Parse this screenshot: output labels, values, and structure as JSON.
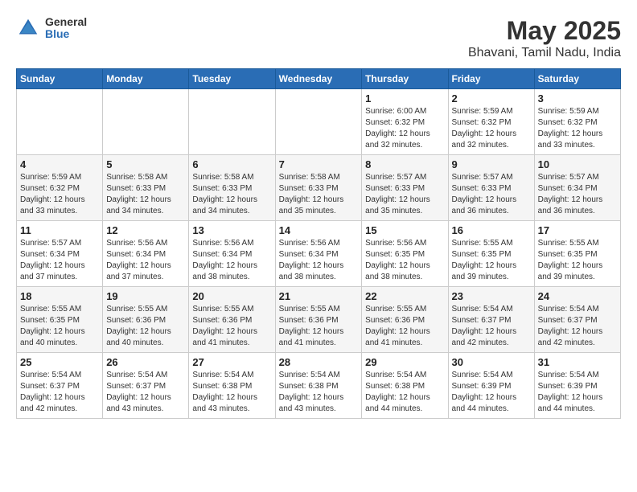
{
  "logo": {
    "general": "General",
    "blue": "Blue"
  },
  "title": "May 2025",
  "subtitle": "Bhavani, Tamil Nadu, India",
  "headers": [
    "Sunday",
    "Monday",
    "Tuesday",
    "Wednesday",
    "Thursday",
    "Friday",
    "Saturday"
  ],
  "weeks": [
    [
      {
        "day": "",
        "info": ""
      },
      {
        "day": "",
        "info": ""
      },
      {
        "day": "",
        "info": ""
      },
      {
        "day": "",
        "info": ""
      },
      {
        "day": "1",
        "info": "Sunrise: 6:00 AM\nSunset: 6:32 PM\nDaylight: 12 hours\nand 32 minutes."
      },
      {
        "day": "2",
        "info": "Sunrise: 5:59 AM\nSunset: 6:32 PM\nDaylight: 12 hours\nand 32 minutes."
      },
      {
        "day": "3",
        "info": "Sunrise: 5:59 AM\nSunset: 6:32 PM\nDaylight: 12 hours\nand 33 minutes."
      }
    ],
    [
      {
        "day": "4",
        "info": "Sunrise: 5:59 AM\nSunset: 6:32 PM\nDaylight: 12 hours\nand 33 minutes."
      },
      {
        "day": "5",
        "info": "Sunrise: 5:58 AM\nSunset: 6:33 PM\nDaylight: 12 hours\nand 34 minutes."
      },
      {
        "day": "6",
        "info": "Sunrise: 5:58 AM\nSunset: 6:33 PM\nDaylight: 12 hours\nand 34 minutes."
      },
      {
        "day": "7",
        "info": "Sunrise: 5:58 AM\nSunset: 6:33 PM\nDaylight: 12 hours\nand 35 minutes."
      },
      {
        "day": "8",
        "info": "Sunrise: 5:57 AM\nSunset: 6:33 PM\nDaylight: 12 hours\nand 35 minutes."
      },
      {
        "day": "9",
        "info": "Sunrise: 5:57 AM\nSunset: 6:33 PM\nDaylight: 12 hours\nand 36 minutes."
      },
      {
        "day": "10",
        "info": "Sunrise: 5:57 AM\nSunset: 6:34 PM\nDaylight: 12 hours\nand 36 minutes."
      }
    ],
    [
      {
        "day": "11",
        "info": "Sunrise: 5:57 AM\nSunset: 6:34 PM\nDaylight: 12 hours\nand 37 minutes."
      },
      {
        "day": "12",
        "info": "Sunrise: 5:56 AM\nSunset: 6:34 PM\nDaylight: 12 hours\nand 37 minutes."
      },
      {
        "day": "13",
        "info": "Sunrise: 5:56 AM\nSunset: 6:34 PM\nDaylight: 12 hours\nand 38 minutes."
      },
      {
        "day": "14",
        "info": "Sunrise: 5:56 AM\nSunset: 6:34 PM\nDaylight: 12 hours\nand 38 minutes."
      },
      {
        "day": "15",
        "info": "Sunrise: 5:56 AM\nSunset: 6:35 PM\nDaylight: 12 hours\nand 38 minutes."
      },
      {
        "day": "16",
        "info": "Sunrise: 5:55 AM\nSunset: 6:35 PM\nDaylight: 12 hours\nand 39 minutes."
      },
      {
        "day": "17",
        "info": "Sunrise: 5:55 AM\nSunset: 6:35 PM\nDaylight: 12 hours\nand 39 minutes."
      }
    ],
    [
      {
        "day": "18",
        "info": "Sunrise: 5:55 AM\nSunset: 6:35 PM\nDaylight: 12 hours\nand 40 minutes."
      },
      {
        "day": "19",
        "info": "Sunrise: 5:55 AM\nSunset: 6:36 PM\nDaylight: 12 hours\nand 40 minutes."
      },
      {
        "day": "20",
        "info": "Sunrise: 5:55 AM\nSunset: 6:36 PM\nDaylight: 12 hours\nand 41 minutes."
      },
      {
        "day": "21",
        "info": "Sunrise: 5:55 AM\nSunset: 6:36 PM\nDaylight: 12 hours\nand 41 minutes."
      },
      {
        "day": "22",
        "info": "Sunrise: 5:55 AM\nSunset: 6:36 PM\nDaylight: 12 hours\nand 41 minutes."
      },
      {
        "day": "23",
        "info": "Sunrise: 5:54 AM\nSunset: 6:37 PM\nDaylight: 12 hours\nand 42 minutes."
      },
      {
        "day": "24",
        "info": "Sunrise: 5:54 AM\nSunset: 6:37 PM\nDaylight: 12 hours\nand 42 minutes."
      }
    ],
    [
      {
        "day": "25",
        "info": "Sunrise: 5:54 AM\nSunset: 6:37 PM\nDaylight: 12 hours\nand 42 minutes."
      },
      {
        "day": "26",
        "info": "Sunrise: 5:54 AM\nSunset: 6:37 PM\nDaylight: 12 hours\nand 43 minutes."
      },
      {
        "day": "27",
        "info": "Sunrise: 5:54 AM\nSunset: 6:38 PM\nDaylight: 12 hours\nand 43 minutes."
      },
      {
        "day": "28",
        "info": "Sunrise: 5:54 AM\nSunset: 6:38 PM\nDaylight: 12 hours\nand 43 minutes."
      },
      {
        "day": "29",
        "info": "Sunrise: 5:54 AM\nSunset: 6:38 PM\nDaylight: 12 hours\nand 44 minutes."
      },
      {
        "day": "30",
        "info": "Sunrise: 5:54 AM\nSunset: 6:39 PM\nDaylight: 12 hours\nand 44 minutes."
      },
      {
        "day": "31",
        "info": "Sunrise: 5:54 AM\nSunset: 6:39 PM\nDaylight: 12 hours\nand 44 minutes."
      }
    ]
  ]
}
